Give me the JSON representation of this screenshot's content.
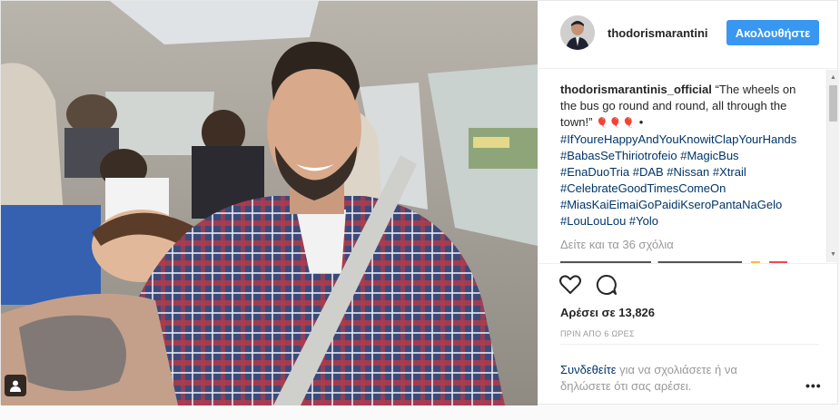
{
  "header": {
    "username": "thodorismarantini",
    "follow_label": "Ακολουθήστε"
  },
  "caption": {
    "author": "thodorismarantinis_official",
    "text": "“The wheels on the bus go round and round, all through the town!”",
    "hearts": "🎈🎈🎈",
    "bullet": " •",
    "hashtags": "#IfYoureHappyAndYouKnowitClapYourHands #BabasSeThiriotrofeio #MagicBus #EnaDuoTria #DAB #Nissan #Xtrail #CelebrateGoodTimesComeOn #MiasKaiEimaiGoPaidiKseroPantaNaGelo #LouLouLou #Yolo"
  },
  "comments": {
    "load_more": "Δείτε και τα 36 σχόλια"
  },
  "actions": {
    "heart_icon": "heart-icon",
    "comment_icon": "comment-icon"
  },
  "likes": "Αρέσει σε 13,826",
  "time": "ΠΡΙΝ ΑΠΟ 6 ΩΡΕΣ",
  "login": {
    "link": "Συνδεθείτε",
    "text": " για να σχολιάσετε ή να δηλώσετε ότι σας αρέσει."
  },
  "more_label": "•••",
  "colors": {
    "accent": "#3897f0",
    "link": "#003569",
    "muted": "#999999"
  }
}
